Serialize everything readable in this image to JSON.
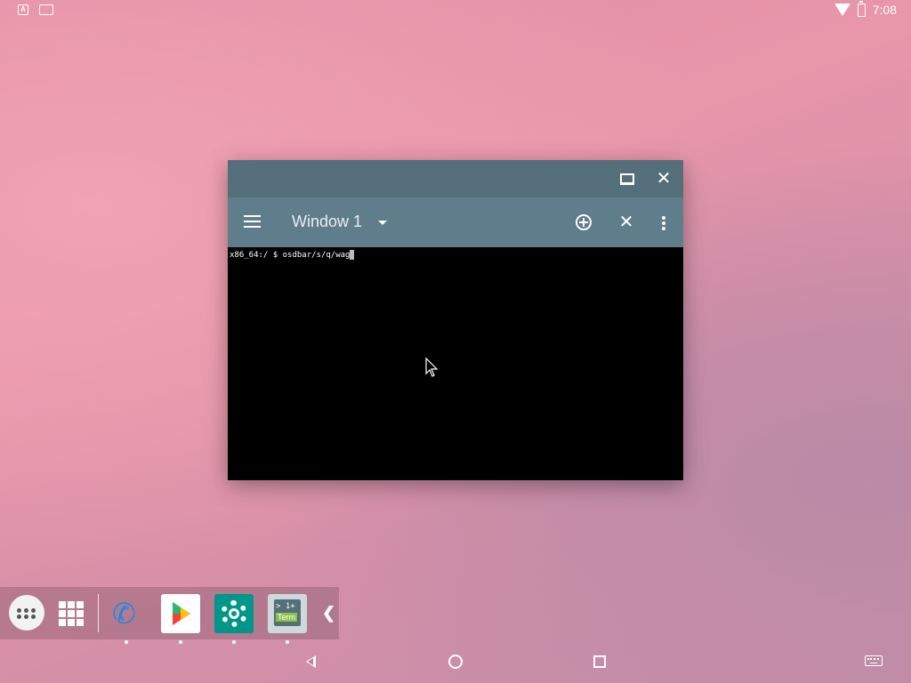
{
  "status_bar": {
    "left_icons": [
      "font-icon",
      "image-icon"
    ],
    "font_icon_text": "A",
    "time": "7:08",
    "right_icons": [
      "wifi-icon",
      "battery-icon"
    ]
  },
  "window": {
    "title": "Window 1",
    "prompt_text": "x86_64:/ $ osdbar/s/q/wag",
    "colors": {
      "titlebar": "#546e7a",
      "toolbar": "#607d8b",
      "terminal_bg": "#000000"
    }
  },
  "dock": {
    "apps": [
      {
        "name": "apps-drawer"
      },
      {
        "name": "grid-view"
      },
      {
        "name": "phone"
      },
      {
        "name": "play-store"
      },
      {
        "name": "settings"
      },
      {
        "name": "terminal",
        "screen_text": "> 1+",
        "label": "Term"
      }
    ],
    "collapse_glyph": "❮"
  },
  "nav_bar": {
    "buttons": [
      "back",
      "home",
      "recents",
      "keyboard"
    ]
  }
}
